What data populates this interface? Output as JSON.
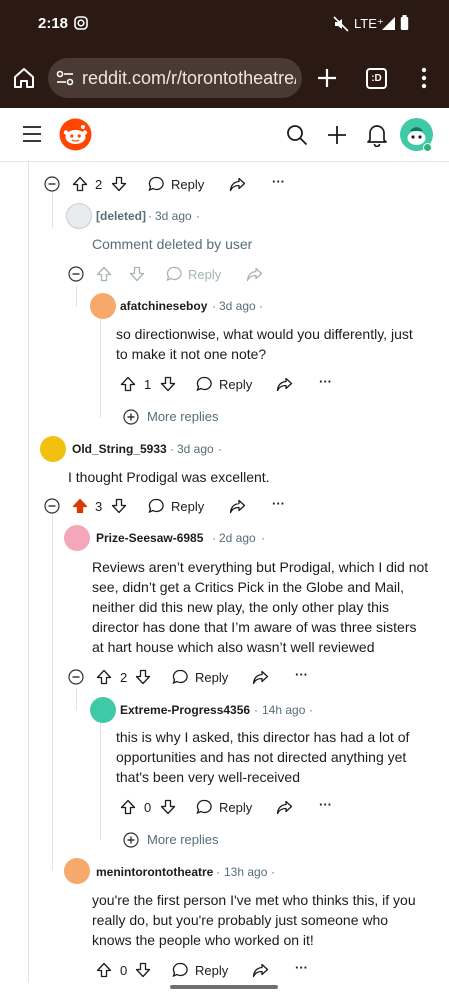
{
  "status_bar": {
    "time": "2:18",
    "network": "LTE⁺"
  },
  "browser": {
    "url": "reddit.com/r/torontotheatre/c",
    "tab_badge": ":D"
  },
  "reddit_header": {
    "menu_icon": "hamburger-icon",
    "logo": "reddit-snoo-logo"
  },
  "comments": {
    "c0": {
      "votes": "2",
      "reply_label": "Reply"
    },
    "c1": {
      "user": "[deleted]",
      "time": "3d ago",
      "text": "Comment deleted by user",
      "reply_label": "Reply"
    },
    "c2": {
      "user": "afatchineseboy",
      "time": "3d ago",
      "text": "so directionwise, what would you differently, just to make it not one note?",
      "votes": "1",
      "reply_label": "Reply",
      "more_replies": "More replies"
    },
    "c3": {
      "user": "Old_String_5933",
      "time": "3d ago",
      "text": "I thought Prodigal was excellent.",
      "votes": "3",
      "reply_label": "Reply"
    },
    "c4": {
      "user": "Prize-Seesaw-6985",
      "time": "2d ago",
      "text": "Reviews aren’t everything but Prodigal, which I did not see, didn’t get a Critics Pick in the Globe and Mail, neither did this new play, the only other play this director has done that I’m aware of was three sisters at hart house which also wasn’t well reviewed",
      "votes": "2",
      "reply_label": "Reply"
    },
    "c5": {
      "user": "Extreme-Progress4356",
      "time": "14h ago",
      "text": "this is why I asked, this director has had a lot of opportunities and has not directed anything yet that's been very well-received",
      "votes": "0",
      "reply_label": "Reply",
      "more_replies": "More replies"
    },
    "c6": {
      "user": "menintorontotheatre",
      "time": "13h ago",
      "text": "you're the first person I've met who thinks this, if you really do, but you're probably just someone who knows the people who worked on it!",
      "votes": "0",
      "reply_label": "Reply"
    }
  },
  "separator": "·",
  "colors": {
    "upvoted": "#d93a00",
    "accent_green": "#3fc9a7",
    "status_bg": "#2b1a14"
  }
}
